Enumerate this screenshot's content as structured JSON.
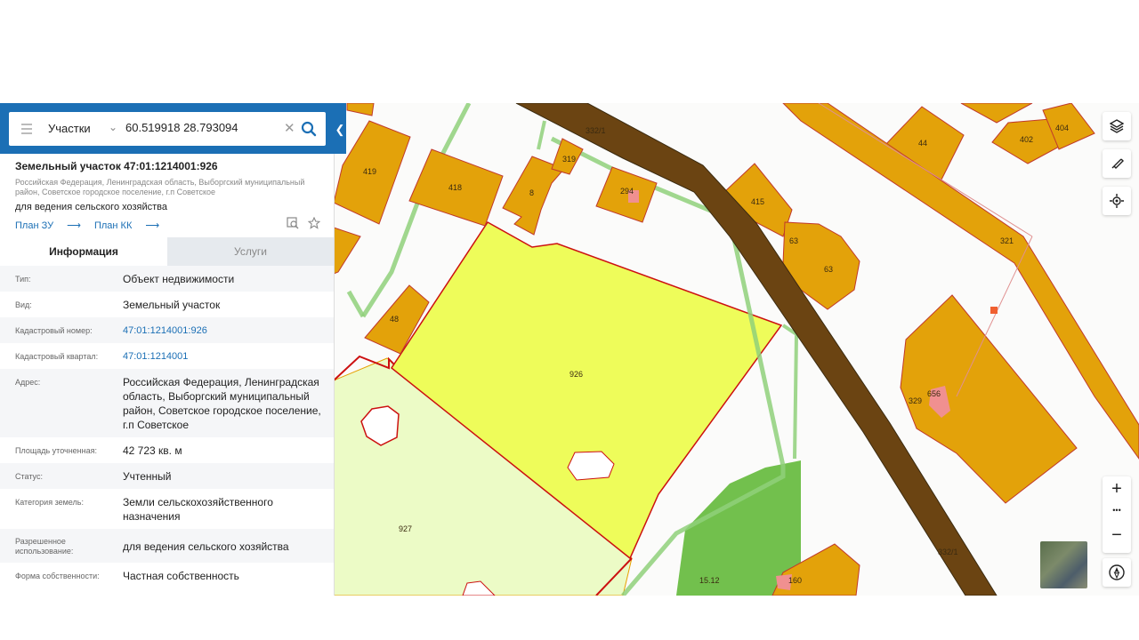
{
  "search": {
    "mode": "Участки",
    "query": "60.519918 28.793094"
  },
  "object": {
    "title": "Земельный участок 47:01:1214001:926",
    "address_small": "Российская Федерация, Ленинградская область, Выборгский муниципальный район, Советское городское поселение, г.п Советское",
    "purpose": "для ведения сельского хозяйства",
    "links": [
      "План ЗУ",
      "План КК"
    ]
  },
  "tabs": {
    "info": "Информация",
    "services": "Услуги"
  },
  "properties": [
    {
      "label": "Тип:",
      "value": "Объект недвижимости"
    },
    {
      "label": "Вид:",
      "value": "Земельный участок"
    },
    {
      "label": "Кадастровый номер:",
      "value": "47:01:1214001:926"
    },
    {
      "label": "Кадастровый квартал:",
      "value": "47:01:1214001"
    },
    {
      "label": "Адрес:",
      "value": "Российская Федерация, Ленинградская область, Выборгский муниципальный район, Советское городское поселение, г.п Советское"
    },
    {
      "label": "Площадь уточненная:",
      "value": "42 723 кв. м"
    },
    {
      "label": "Статус:",
      "value": "Учтенный"
    },
    {
      "label": "Категория земель:",
      "value": "Земли сельскохозяйственного назначения"
    },
    {
      "label": "Разрешенное использование:",
      "value": "для ведения сельского хозяйства"
    },
    {
      "label": "Форма собственности:",
      "value": "Частная собственность"
    }
  ],
  "map": {
    "labels": {
      "p419": "419",
      "p418": "418",
      "p8": "8",
      "p319": "319",
      "p332_1": "332/1",
      "p294": "294",
      "p415": "415",
      "p44": "44",
      "p402": "402",
      "p404": "404",
      "p321": "321",
      "p63": "63",
      "p63b": "63",
      "p48": "48",
      "p926": "926",
      "p927": "927",
      "p329": "329",
      "p656": "656",
      "p15_12": "15.12",
      "p160": "160",
      "p332_1b": "332/1"
    },
    "colors": {
      "parcel": "#e3a20a",
      "selected": "#eefc5a",
      "road": "#6b4412",
      "green": "#72c04d"
    }
  },
  "controls": {
    "zoom_in": "+",
    "more": "•••",
    "zoom_out": "−"
  }
}
